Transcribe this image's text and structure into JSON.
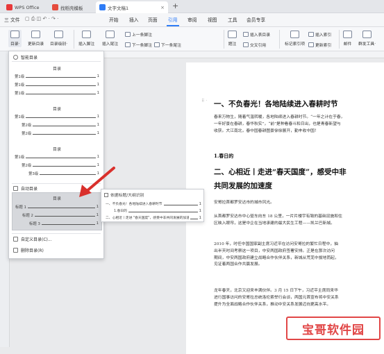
{
  "tabs": {
    "wps": "WPS Office",
    "template": "找稻壳模板",
    "document": "文字文稿1",
    "close": "×",
    "new": "+"
  },
  "menubar": {
    "file": "三 文件",
    "items": [
      "开始",
      "插入",
      "页面",
      "引用",
      "审阅",
      "视图",
      "工具",
      "会员专享"
    ],
    "active_index": 3
  },
  "ribbon": {
    "toc": "目录·",
    "update_toc": "更新目录",
    "toc_level": "目录级别·",
    "insert_footnote": "插入脚注",
    "next_footnote": "下一条脚注",
    "insert_endnote": "插入尾注",
    "prev_footnote": "上一条脚注",
    "next_endnote": "下一条尾注",
    "insert_caption": "题注",
    "insert_table_of_figures": "插入表目录",
    "cross_reference": "交叉引用",
    "mark_index": "标记索引项",
    "insert_index": "插入索引",
    "update_index": "更新索引",
    "mail": "邮件",
    "mail_merge": "群发工具·"
  },
  "toc_panel": {
    "smart_toc": "智能目录",
    "card_title": "目录",
    "card1": [
      {
        "label": "第1级",
        "page": "1"
      },
      {
        "label": "第1级",
        "page": "1"
      },
      {
        "label": "第1级",
        "page": "1"
      }
    ],
    "card2": [
      {
        "label": "第1级",
        "page": "1"
      },
      {
        "label": "第2级",
        "page": "1"
      },
      {
        "label": "第2级",
        "page": "1"
      }
    ],
    "card3": [
      {
        "label": "第1级",
        "page": "1"
      },
      {
        "label": "第2级",
        "page": "1"
      },
      {
        "label": "第3级",
        "page": "1"
      }
    ],
    "auto_toc": "自动目录",
    "auto_card": [
      {
        "label": "标题 1",
        "page": "1"
      },
      {
        "label": "标题 2",
        "page": "1"
      },
      {
        "label": "标题 3",
        "page": "1"
      }
    ],
    "custom_toc": "自定义目录(C)...",
    "delete_toc": "删除目录(R)"
  },
  "flyout": {
    "title": "依据标题/大纲识别",
    "lines": [
      {
        "label": "一、不负春光！各地陆续进入春耕时节",
        "page": "1"
      },
      {
        "label": "1.春日的",
        "page": "1"
      },
      {
        "label": "二、心相近丨走进 \"春天国度\"，感受中非共同发展的加速度",
        "page": "1"
      }
    ]
  },
  "document": {
    "heading1": "一、不负春光！各地陆续进入春耕时节",
    "para1": [
      "春来万物生，随着气温转暖，各地陆续进入春耕时节。“一年之计在于春，",
      "一年好景在春耕，春华秋实”，“前”是种看春斗和日出，也是青春新望与",
      "收获。大江南北，春中国春耕图景徐徐展开，勤丰收中国！"
    ],
    "sub1": "1.春日的",
    "heading2a": "二、心相近丨走进“春天国度”，感受中非",
    "heading2b": "共同发展的加速度",
    "para2": [
      "安哥拉首都罗安达市的城市风光。"
    ],
    "para3": [
      "从首都罗安达市中心驱车向东 18 公里，一片片楼宇有致的基础设施和住",
      "区映入眼帘，这是中企在当地承建的最大民生工程——凯兰巴新城。"
    ],
    "para4": [
      "2010 年，时任中国国家副主席习近平在访问安哥拉的繁忙日程中，抽",
      "出半天时间考察这一项目，中安两国政府签署安排。正是在那次访问",
      "期间，中安两国政府建立战略合作伙伴关系，新城从荒芜中拔地而起，",
      "见证着两国合作共赢发展。"
    ],
    "para5": [
      "龙年春天，北京又迎来丰满伙伴。3 月 15 日下午，习近平主席同来华",
      "进行国事访问的安哥拉总统洛伦索举行会谈，两国元首宣布将中安关系",
      "提升为全面战略合作伙伴关系，推动中安关系发展迈向更高水平。"
    ]
  },
  "watermark": "宝哥软件园"
}
